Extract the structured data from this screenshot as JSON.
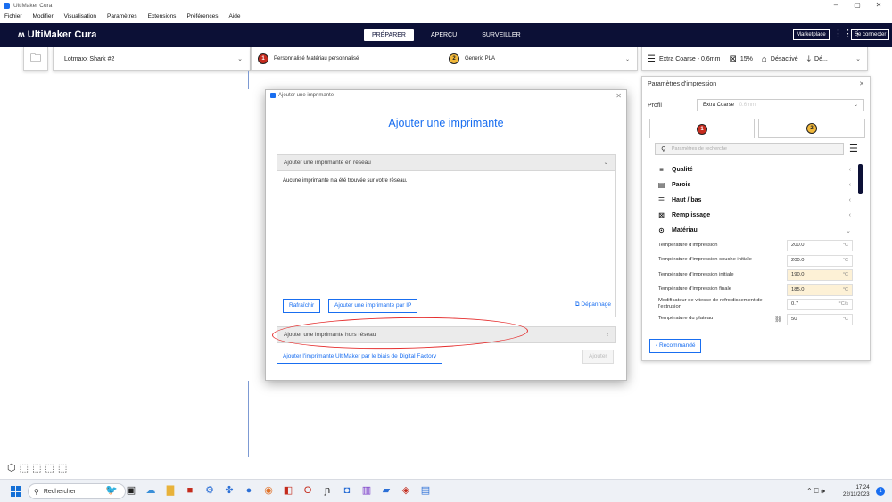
{
  "window": {
    "title": "UltiMaker Cura",
    "minimize": "–",
    "maximize": "▢",
    "close": "✕"
  },
  "menu": [
    "Fichier",
    "Modifier",
    "Visualisation",
    "Paramètres",
    "Extensions",
    "Préférences",
    "Aide"
  ],
  "header": {
    "logo": "UltiMaker Cura",
    "tabs": [
      "PRÉPARER",
      "APERÇU",
      "SURVEILLER"
    ],
    "active_tab": "PRÉPARER",
    "marketplace": "Marketplace",
    "connect": "Se connecter"
  },
  "config": {
    "printer": "Lotmaxx Shark #2",
    "extruder1_num": "1",
    "extruder1_label": "Personnalisé Matériau personnalisé",
    "extruder2_num": "2",
    "extruder2_label": "Generic PLA",
    "profile": "Extra Coarse - 0.6mm",
    "infill": "15%",
    "support": "Désactivé",
    "adhesion": "Dé..."
  },
  "dialog": {
    "window_title": "Ajouter une imprimante",
    "heading": "Ajouter une imprimante",
    "network_section": "Ajouter une imprimante en réseau",
    "network_message": "Aucune imprimante n'a été trouvée sur votre réseau.",
    "refresh_button": "Rafraîchir",
    "add_by_ip_button": "Ajouter une imprimante par IP",
    "troubleshoot_link": "Dépannage",
    "offline_section": "Ajouter une imprimante hors réseau",
    "digital_factory_button": "Ajouter l'imprimante UltiMaker par le biais de Digital Factory",
    "add_button": "Ajouter"
  },
  "panel": {
    "title": "Paramètres d'impression",
    "profile_label": "Profil",
    "profile_value": "Extra Coarse",
    "profile_sub": "0.6mm",
    "search_placeholder": "Paramètres de recherche",
    "categories": [
      "Qualité",
      "Parois",
      "Haut / bas",
      "Remplissage",
      "Matériau"
    ],
    "settings": [
      {
        "label": "Température d'impression",
        "value": "200.0",
        "unit": "°C",
        "changed": false
      },
      {
        "label": "Température d'impression couche initiale",
        "value": "200.0",
        "unit": "°C",
        "changed": false
      },
      {
        "label": "Température d'impression initiale",
        "value": "190.0",
        "unit": "°C",
        "changed": true
      },
      {
        "label": "Température d'impression finale",
        "value": "185.0",
        "unit": "°C",
        "changed": true
      },
      {
        "label": "Modificateur de vitesse de refroidissement de l'extrusion",
        "value": "0.7",
        "unit": "°C/s",
        "changed": false
      },
      {
        "label": "Température du plateau",
        "value": "50",
        "unit": "°C",
        "changed": false
      }
    ],
    "recommended_button": "Recommandé"
  },
  "taskbar": {
    "search": "Rechercher",
    "time": "17:24",
    "date": "22/11/2023",
    "notification_count": "1"
  }
}
